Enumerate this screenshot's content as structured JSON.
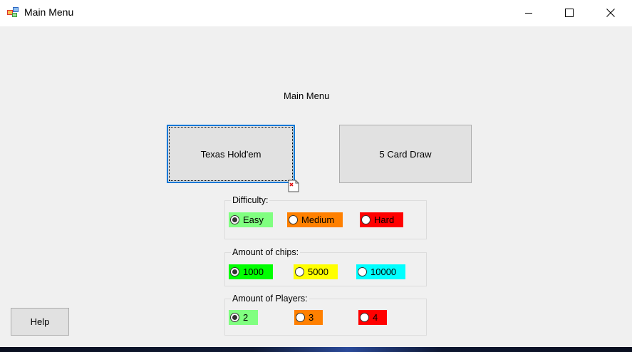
{
  "window": {
    "title": "Main Menu"
  },
  "main": {
    "heading": "Main Menu",
    "texas_button": "Texas Hold'em",
    "draw_button": "5 Card Draw",
    "help_button": "Help"
  },
  "difficulty": {
    "label": "Difficulty:",
    "options": [
      {
        "label": "Easy",
        "checked": true,
        "color": "#80ff80"
      },
      {
        "label": "Medium",
        "checked": false,
        "color": "#ff8000"
      },
      {
        "label": "Hard",
        "checked": false,
        "color": "#ff0000"
      }
    ]
  },
  "chips": {
    "label": "Amount of chips:",
    "options": [
      {
        "label": "1000",
        "checked": true,
        "color": "#00ff00"
      },
      {
        "label": "5000",
        "checked": false,
        "color": "#ffff00"
      },
      {
        "label": "10000",
        "checked": false,
        "color": "#00ffff"
      }
    ]
  },
  "players": {
    "label": "Amount of Players:",
    "options": [
      {
        "label": "2",
        "checked": true,
        "color": "#80ff80"
      },
      {
        "label": "3",
        "checked": false,
        "color": "#ff8000"
      },
      {
        "label": "4",
        "checked": false,
        "color": "#ff0000"
      }
    ]
  },
  "icons": {
    "app": "app-icon",
    "minimize": "minimize-icon",
    "maximize": "maximize-icon",
    "close": "close-icon",
    "image_placeholder": "broken-image-icon"
  }
}
